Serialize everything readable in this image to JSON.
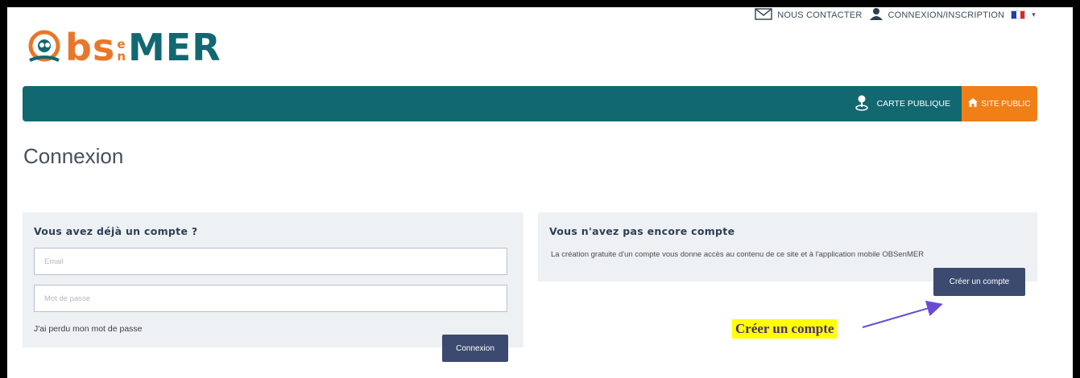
{
  "header": {
    "logo": {
      "prefix": "bs",
      "en_top": "e",
      "en_bottom": "n",
      "suffix": "MER"
    },
    "contact_label": "NOUS CONTACTER",
    "login_label": "CONNEXION/INSCRIPTION",
    "language": "FR"
  },
  "nav": {
    "carte_label": "CARTE PUBLIQUE",
    "site_label": "SITE PUBLIC"
  },
  "page": {
    "title": "Connexion"
  },
  "login_panel": {
    "heading": "Vous avez déjà un compte ?",
    "email_placeholder": "Email",
    "password_placeholder": "Mot de passe",
    "forgot_label": "J'ai perdu mon mot de passe",
    "submit_label": "Connexion"
  },
  "signup_panel": {
    "heading": "Vous n'avez pas encore compte",
    "description": "La création gratuite d'un compte vous donne accès au contenu de ce site et à l'application mobile OBSenMER",
    "button_label": "Créer un compte"
  },
  "annotation": {
    "label": "Créer un compte",
    "highlight_color": "#ffff00",
    "arrow_color": "#6a4bd6"
  },
  "colors": {
    "brand_teal": "#116870",
    "brand_orange": "#f07f18",
    "button": "#3b4a6e"
  }
}
